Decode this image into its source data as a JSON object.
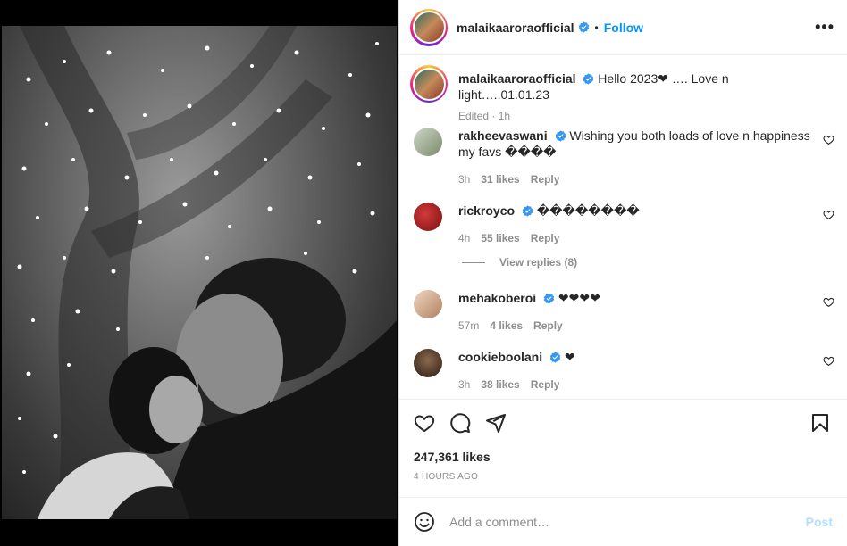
{
  "post": {
    "username": "malaikaaroraofficial",
    "separator": "•",
    "follow_label": "Follow",
    "more_label": "•••",
    "caption": {
      "username": "malaikaaroraofficial",
      "text": "Hello 2023❤ …. Love n light…..01.01.23",
      "meta": "Edited · 1h"
    }
  },
  "comments": [
    {
      "username": "rakheevaswani",
      "text": "Wishing you both loads of love n happiness my favs ����",
      "time": "3h",
      "likes": "31 likes",
      "reply": "Reply"
    },
    {
      "username": "rickroyco",
      "text": "��������",
      "time": "4h",
      "likes": "55 likes",
      "reply": "Reply"
    },
    {
      "username": "mehakoberoi",
      "text": "❤❤❤❤",
      "time": "57m",
      "likes": "4 likes",
      "reply": "Reply"
    },
    {
      "username": "cookieboolani",
      "text": "❤",
      "time": "3h",
      "likes": "38 likes",
      "reply": "Reply"
    }
  ],
  "view_replies": "View replies (8)",
  "likes_count": "247,361 likes",
  "posted_time": "4 HOURS AGO",
  "add_comment": {
    "placeholder": "Add a comment…",
    "post_label": "Post"
  },
  "colors": {
    "accent": "#0095f6",
    "verified": "#3897f0",
    "post_disabled": "#b2dffc"
  },
  "icons": [
    "verified-badge-icon",
    "heart-icon",
    "comment-icon",
    "share-icon",
    "bookmark-icon",
    "emoji-icon",
    "more-icon"
  ]
}
